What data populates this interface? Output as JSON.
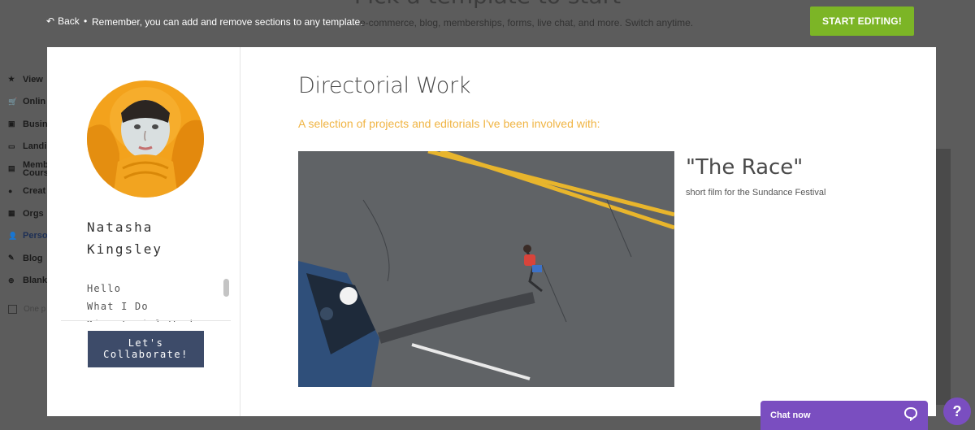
{
  "background": {
    "heading": "Pick a template to start",
    "subtext": "e-commerce, blog, memberships, forms, live chat, and more. Switch anytime.",
    "sidebar": [
      {
        "label": "View",
        "icon": "star-icon"
      },
      {
        "label": "Onlin",
        "icon": "cart-icon"
      },
      {
        "label": "Busin",
        "icon": "briefcase-icon"
      },
      {
        "label": "Landi",
        "icon": "window-icon"
      },
      {
        "label": "Memb Cours",
        "icon": "card-icon"
      },
      {
        "label": "Creat",
        "icon": "palette-icon"
      },
      {
        "label": "Orgs",
        "icon": "building-icon"
      },
      {
        "label": "Perso",
        "icon": "person-icon"
      },
      {
        "label": "Blog",
        "icon": "pencil-icon"
      },
      {
        "label": "Blank",
        "icon": "plus-circle-icon"
      },
      {
        "label": "One p",
        "icon": "checkbox-icon"
      }
    ]
  },
  "topbar": {
    "back_label": "Back",
    "separator": "•",
    "reminder": "Remember, you can add and remove sections to any template.",
    "start_button": "START EDITING!"
  },
  "profile": {
    "name_first": "Natasha",
    "name_last": "Kingsley",
    "nav": [
      "Hello",
      "What I Do",
      "Directorial Work"
    ],
    "cta_line1": "Let's",
    "cta_line2": "Collaborate!"
  },
  "section": {
    "title": "Directorial Work",
    "subtitle": "A selection of projects and editorials I've been involved with:"
  },
  "project": {
    "title": "\"The Race\"",
    "description": "short film for the Sundance Festival"
  },
  "chat": {
    "label": "Chat now",
    "help": "?"
  },
  "colors": {
    "accent_green": "#7cb526",
    "accent_orange": "#f0b443",
    "button_navy": "#3d4b69",
    "chat_purple": "#7a4ec0"
  }
}
